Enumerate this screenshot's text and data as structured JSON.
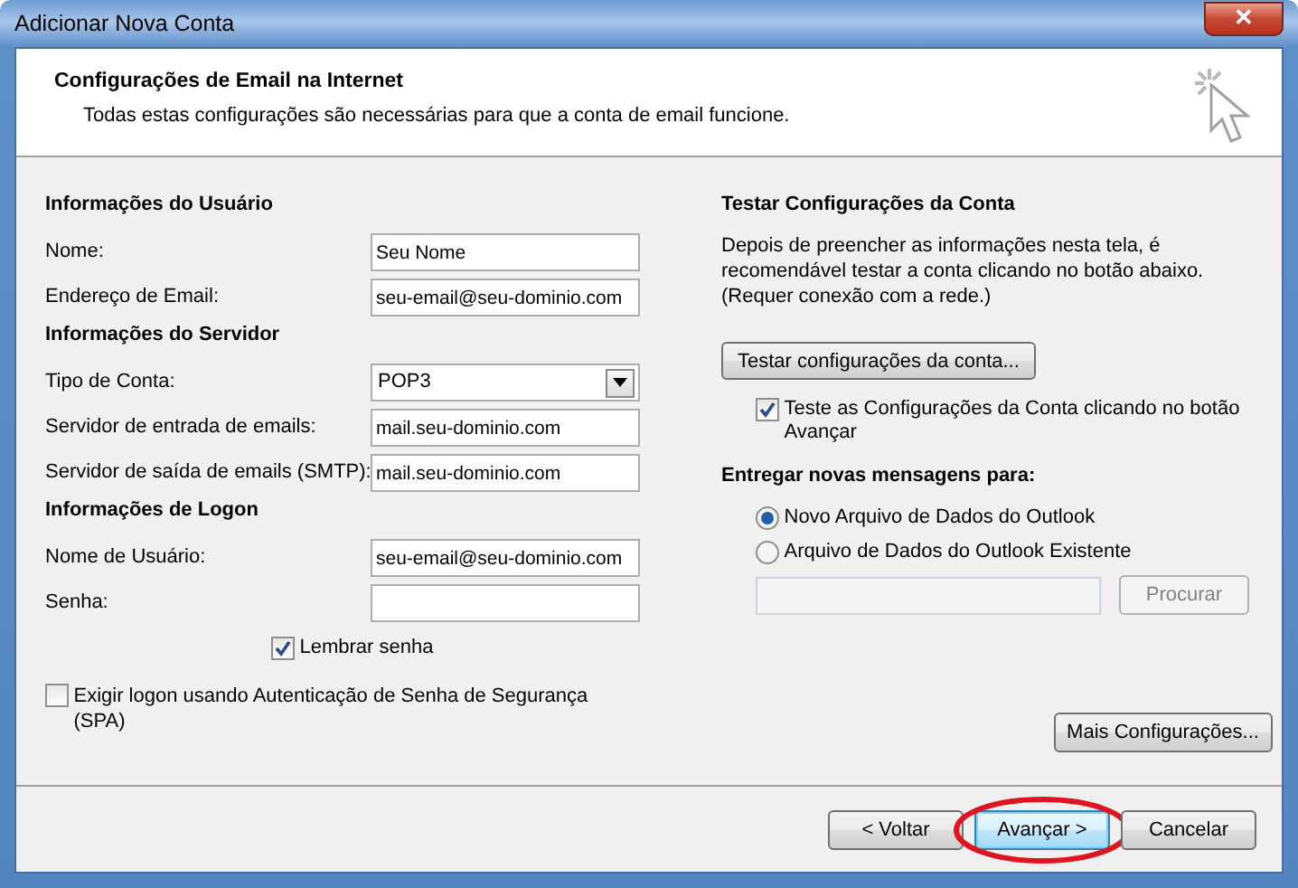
{
  "window": {
    "title": "Adicionar Nova Conta",
    "close": "✕"
  },
  "header": {
    "title": "Configurações de Email na Internet",
    "subtitle": "Todas estas configurações são necessárias para que a conta de email funcione."
  },
  "sections": [
    {
      "heading": "Informações do Usuário",
      "fields": [
        {
          "label": "Nome:",
          "kind": "text",
          "value": "Seu Nome"
        },
        {
          "label": "Endereço de Email:",
          "kind": "text",
          "value": "seu-email@seu-dominio.com"
        }
      ]
    },
    {
      "heading": "Informações do Servidor",
      "fields": [
        {
          "label": "Tipo de Conta:",
          "kind": "select",
          "value": "POP3"
        },
        {
          "label": "Servidor de entrada de emails:",
          "kind": "text",
          "value": "mail.seu-dominio.com"
        },
        {
          "label": "Servidor de saída de emails (SMTP):",
          "kind": "text",
          "value": "mail.seu-dominio.com"
        }
      ]
    },
    {
      "heading": "Informações de Logon",
      "fields": [
        {
          "label": "Nome de Usuário:",
          "kind": "text",
          "value": "seu-email@seu-dominio.com"
        },
        {
          "label": "Senha:",
          "kind": "password"
        }
      ]
    }
  ],
  "remember_password": {
    "label": "Lembrar senha",
    "checked": true
  },
  "spa": {
    "label": "Exigir logon usando Autenticação de Senha de Segurança (SPA)",
    "checked": false
  },
  "test": {
    "heading": "Testar Configurações da Conta",
    "description": "Depois de preencher as informações nesta tela, é recomendável testar a conta clicando no botão abaixo. (Requer conexão com a rede.)",
    "button": "Testar configurações da conta...",
    "auto_test": {
      "label": "Teste as Configurações da Conta clicando no botão Avançar",
      "checked": true
    }
  },
  "delivery": {
    "heading": "Entregar novas mensagens para:",
    "options": [
      {
        "label": "Novo Arquivo de Dados do Outlook",
        "selected": true
      },
      {
        "label": "Arquivo de Dados do Outlook Existente",
        "selected": false
      }
    ],
    "path_disabled": true,
    "browse": {
      "label": "Procurar",
      "disabled": true
    }
  },
  "more_button": "Mais Configurações...",
  "buttons": [
    {
      "label": "< Voltar",
      "default": false,
      "circled": false
    },
    {
      "label": "Avançar >",
      "default": true,
      "circled": true
    },
    {
      "label": "Cancelar",
      "default": false,
      "circled": false
    }
  ]
}
